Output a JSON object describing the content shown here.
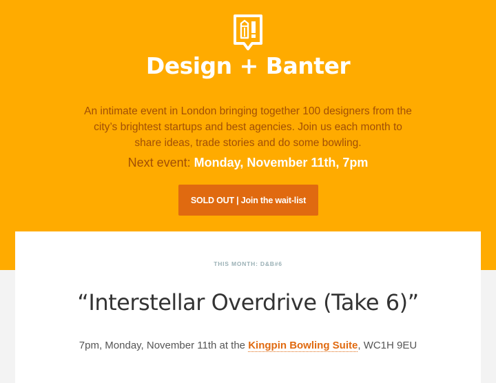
{
  "header": {
    "logo_icon": "pencil-exclamation-speech-bubble-icon",
    "brand": "Design + Banter",
    "intro": "An intimate event in London bringing together 100 designers from the city’s brightest startups and best agencies. Join us each month to share ideas, trade stories and do some bowling.",
    "next_event_label": "Next event:",
    "next_event_date": "Monday, November 11th, 7pm",
    "cta_label": "SOLD OUT | Join the wait-list"
  },
  "event": {
    "kicker": "THIS MONTH: D&B#6",
    "title": "“Interstellar Overdrive (Take 6)”",
    "details_prefix": "7pm, Monday, November 11th at the",
    "venue": "Kingpin Bowling Suite",
    "details_suffix": ", WC1H 9EU"
  },
  "colors": {
    "hero_bg": "#ffab00",
    "accent": "#e06a10",
    "body_text": "#a14f06",
    "page_bg": "#f3f3f3"
  }
}
